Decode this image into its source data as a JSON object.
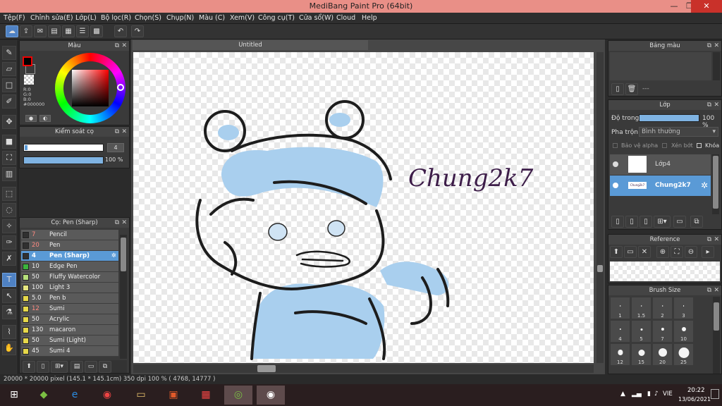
{
  "window": {
    "title": "MediBang Paint Pro (64bit)",
    "minimize": "—",
    "restore": "❐",
    "close": "✕"
  },
  "menu": [
    "Tệp(F)",
    "Chỉnh sửa(E)",
    "Lớp(L)",
    "Bộ lọc(R)",
    "Chọn(S)",
    "Chụp(N)",
    "Màu (C)",
    "Xem(V)",
    "Công cụ(T)",
    "Cửa sổ(W)",
    "Cloud",
    "Help"
  ],
  "color_panel": {
    "title": "Màu",
    "readout": {
      "r": "R:0",
      "g": "G:0",
      "b": "B:0",
      "hex": "#000000"
    },
    "primary_color": "#000000",
    "secondary_color": "#ffffff",
    "buttons": [
      "●",
      "◐"
    ]
  },
  "brush_control": {
    "title": "Kiểm soát cọ",
    "size_value": "4",
    "opacity_value": "100 %",
    "opacity_fraction": 1.0
  },
  "brush_panel": {
    "title": "Cọ: Pen (Sharp)",
    "items": [
      {
        "size": "7",
        "name": "Pencil",
        "color": "#303030",
        "size_color": "#ff8a80"
      },
      {
        "size": "20",
        "name": "Pen",
        "color": "#303030",
        "size_color": "#ff8a80"
      },
      {
        "size": "4",
        "name": "Pen (Sharp)",
        "color": "#303030",
        "size_color": "#ff8a80",
        "selected": true
      },
      {
        "size": "10",
        "name": "Edge Pen",
        "color": "#3cb43c",
        "size_color": "#eeeeee"
      },
      {
        "size": "50",
        "name": "Fluffy Watercolor",
        "color": "#b6e07a",
        "size_color": "#eeeeee"
      },
      {
        "size": "100",
        "name": "Light 3",
        "color": "#e6e680",
        "size_color": "#eeeeee"
      },
      {
        "size": "5.0",
        "name": "Pen b",
        "color": "#e6d84a",
        "size_color": "#eeeeee"
      },
      {
        "size": "12",
        "name": "Sumi",
        "color": "#e6d84a",
        "size_color": "#ff8a80"
      },
      {
        "size": "50",
        "name": "Acrylic",
        "color": "#e6d84a",
        "size_color": "#eeeeee"
      },
      {
        "size": "130",
        "name": "macaron",
        "color": "#e6d84a",
        "size_color": "#eeeeee"
      },
      {
        "size": "50",
        "name": "Sumi (Light)",
        "color": "#e6d84a",
        "size_color": "#eeeeee"
      },
      {
        "size": "45",
        "name": "Sumi 4",
        "color": "#e6d84a",
        "size_color": "#eeeeee"
      }
    ]
  },
  "document": {
    "tab": "Untitled",
    "signature": "Chung2k7"
  },
  "palette_panel": {
    "title": "Bảng màu",
    "placeholder": "---"
  },
  "layer_panel": {
    "title": "Lớp",
    "opacity_label": "Độ trong",
    "opacity_value": "100 %",
    "opacity_fraction": 1.0,
    "blend_label": "Pha trộn",
    "blend_value": "Bình thường",
    "checks": [
      "Bảo vệ alpha",
      "Xén bớt",
      "Khóa"
    ],
    "layers": [
      {
        "name": "Lớp4",
        "selected": false
      },
      {
        "name": "Chung2k7",
        "thumb_text": "Chung2k7",
        "selected": true
      }
    ]
  },
  "reference_panel": {
    "title": "Reference"
  },
  "brush_size_panel": {
    "title": "Brush Size",
    "sizes": [
      "1",
      "1.5",
      "2",
      "3",
      "4",
      "5",
      "7",
      "10",
      "12",
      "15",
      "20",
      "25"
    ]
  },
  "statusbar": {
    "text": "20000 * 20000 pixel  (145.1 * 145.1cm)  350 dpi  100 %  ( 4768, 14777 )"
  },
  "taskbar": {
    "time": "20:22",
    "date": "13/06/2021",
    "lang": "VIE"
  },
  "colors": {
    "accent": "#4f82c4",
    "titlebar": "#e98f87",
    "hair_blue": "#a9cfee"
  }
}
